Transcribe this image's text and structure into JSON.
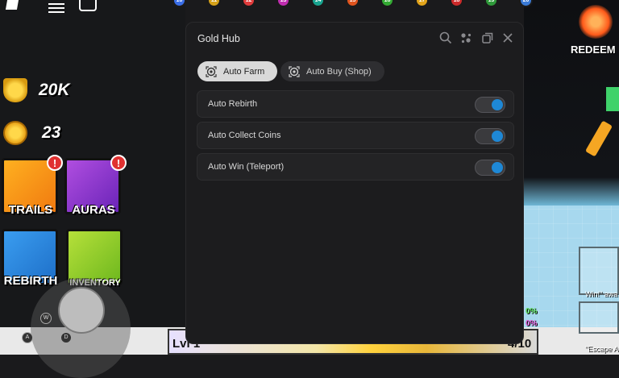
{
  "window": {
    "title": "Gold Hub",
    "tabs": [
      {
        "label": "Auto Farm",
        "active": true
      },
      {
        "label": "Auto Buy (Shop)",
        "active": false
      }
    ],
    "toggles": [
      {
        "label": "Auto Rebirth",
        "on": true
      },
      {
        "label": "Auto Collect Coins",
        "on": true
      },
      {
        "label": "Auto Win (Teleport)",
        "on": true
      }
    ],
    "icons": {
      "search": "search-icon",
      "settings": "settings-icon",
      "minimize": "minimize-icon",
      "close": "close-icon"
    },
    "toggle_color": "#1e88d6"
  },
  "game": {
    "trophies": "20K",
    "coins": "23",
    "tiles": {
      "trails": "TRAILS",
      "auras": "AURAS",
      "rebirth": "REBIRTH",
      "inventory": "INVENTORY"
    },
    "badge": "!",
    "redeem": "REDEEM",
    "level_label": "Lvl 1",
    "level_count": "4/10",
    "keys": {
      "w": "W",
      "a": "A",
      "d": "D"
    },
    "right_texts": {
      "win": "Win!\" awa",
      "escape": "\"Escape A"
    },
    "percent_a": "0%",
    "percent_b": "0%",
    "level_bubbles": [
      "10",
      "11",
      "12",
      "13",
      "14",
      "15",
      "16",
      "17",
      "18",
      "19",
      "20"
    ]
  }
}
